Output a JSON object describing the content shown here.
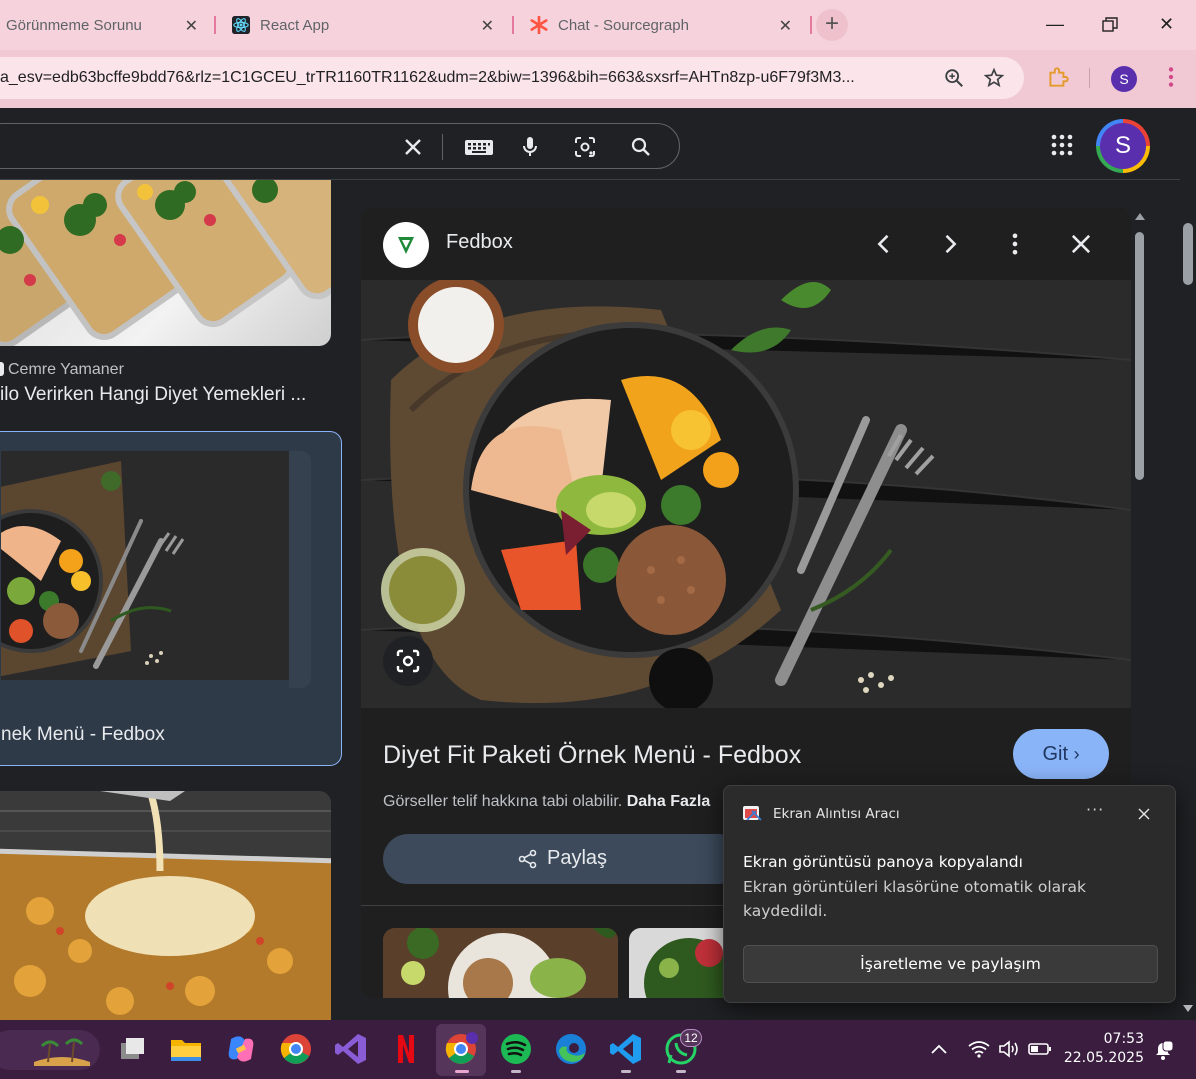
{
  "browser": {
    "tabs": [
      {
        "title": "Görünmeme Sorunu",
        "favicon": "none"
      },
      {
        "title": "React App",
        "favicon": "react-icon"
      },
      {
        "title": "Chat - Sourcegraph",
        "favicon": "sourcegraph-icon"
      }
    ],
    "url": "a_esv=edb63bcffe9bdd76&rlz=1C1GCEU_trTR1160TR1162&udm=2&biw=1396&bih=663&sxsrf=AHTn8zp-u6F79f3M3...",
    "profile_initial": "S"
  },
  "google": {
    "account_initial": "S"
  },
  "results": [
    {
      "source": "Cemre Yamaner",
      "title": "ilo Verirken Hangi Diyet Yemekleri ..."
    },
    {
      "title": "nek Menü - Fedbox"
    }
  ],
  "preview": {
    "site_name": "Fedbox",
    "title": "Diyet Fit Paketi Örnek Menü - Fedbox",
    "visit_label": "Git",
    "copyright_text": "Görseller telif hakkına tabi olabilir.",
    "learn_more": "Daha Fazla",
    "share_label": "Paylaş"
  },
  "snipping_toast": {
    "app_name": "Ekran Alıntısı Aracı",
    "heading": "Ekran görüntüsü panoya kopyalandı",
    "body": "Ekran görüntüleri klasörüne otomatik olarak kaydedildi.",
    "action": "İşaretleme ve paylaşım"
  },
  "taskbar": {
    "apps": [
      "widgets-icon",
      "task-view-icon",
      "file-explorer-icon",
      "copilot-icon",
      "chrome-icon",
      "visual-studio-icon",
      "netflix-icon",
      "chrome-profile-icon",
      "spotify-icon",
      "edge-icon",
      "vscode-icon",
      "whatsapp-icon"
    ],
    "whatsapp_badge": "12",
    "time": "07:53",
    "date": "22.05.2025"
  },
  "colors": {
    "tabstrip": "#f6d3dc",
    "accent_blue": "#8ab4f8",
    "panel_bg": "#1f1f1f",
    "taskbar": "#3a1d3f"
  }
}
